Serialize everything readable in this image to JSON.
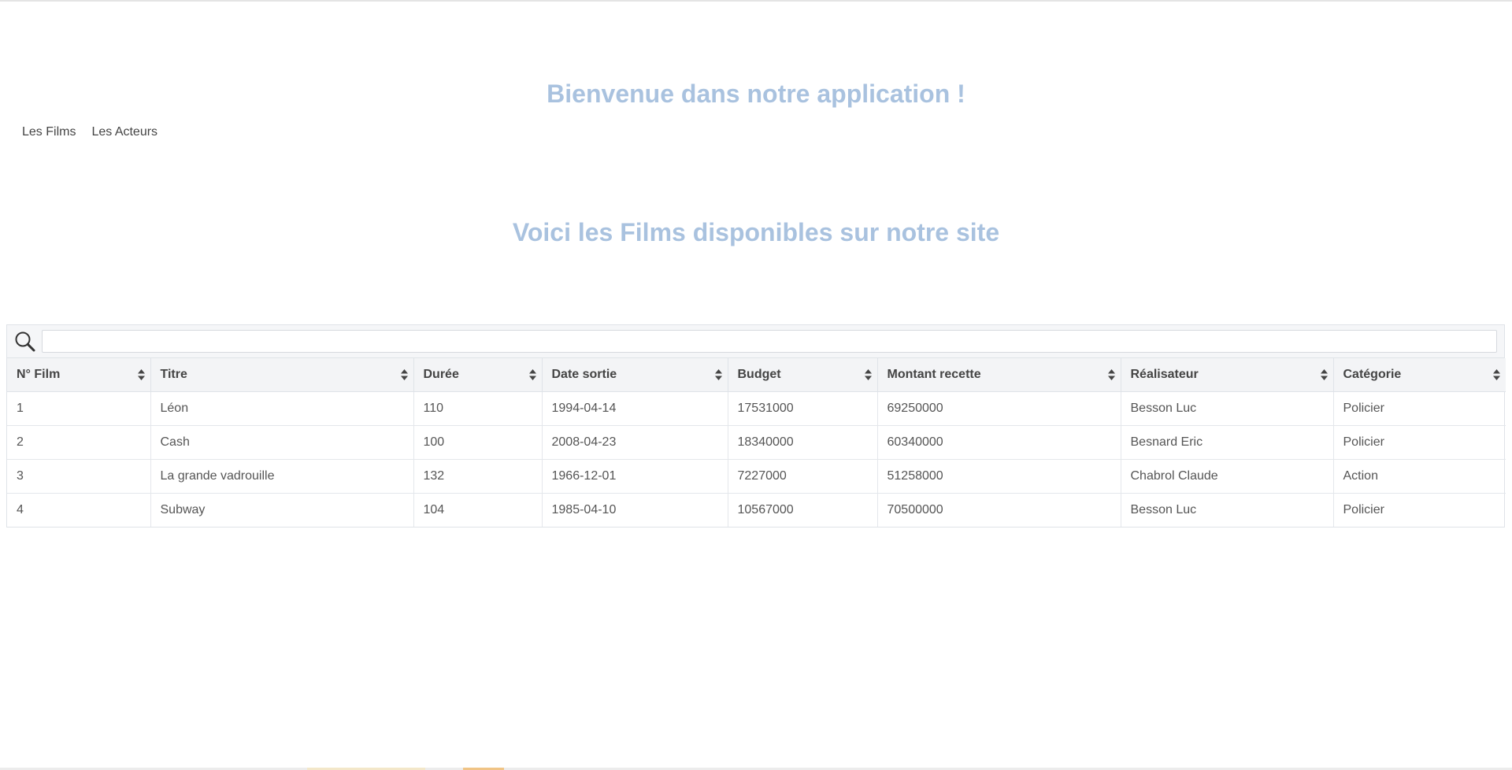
{
  "header": {
    "welcome_title": "Bienvenue dans notre application !"
  },
  "nav": {
    "items": [
      {
        "label": "Les Films"
      },
      {
        "label": "Les Acteurs"
      }
    ]
  },
  "main": {
    "heading": "Voici les Films disponibles sur notre site"
  },
  "search": {
    "icon": "search-icon",
    "value": "",
    "placeholder": ""
  },
  "table": {
    "columns": [
      "N° Film",
      "Titre",
      "Durée",
      "Date sortie",
      "Budget",
      "Montant recette",
      "Réalisateur",
      "Catégorie"
    ],
    "sort_icon": "sort-both-icon",
    "rows": [
      [
        "1",
        "Léon",
        "110",
        "1994-04-14",
        "17531000",
        "69250000",
        "Besson Luc",
        "Policier"
      ],
      [
        "2",
        "Cash",
        "100",
        "2008-04-23",
        "18340000",
        "60340000",
        "Besnard Eric",
        "Policier"
      ],
      [
        "3",
        "La grande vadrouille",
        "132",
        "1966-12-01",
        "7227000",
        "51258000",
        "Chabrol Claude",
        "Action"
      ],
      [
        "4",
        "Subway",
        "104",
        "1985-04-10",
        "10567000",
        "70500000",
        "Besson Luc",
        "Policier"
      ]
    ]
  },
  "colors": {
    "heading": "#a9c2df",
    "text": "#444444",
    "header_bg": "#f3f4f6"
  }
}
